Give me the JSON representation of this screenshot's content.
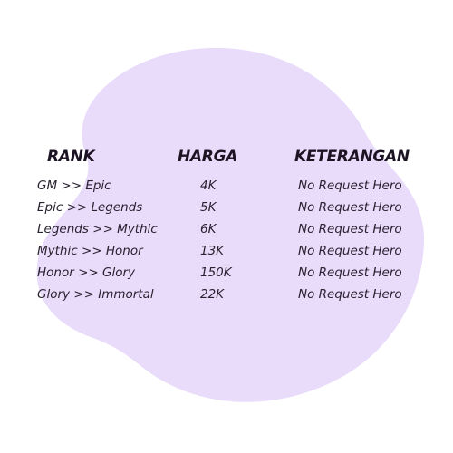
{
  "background_color": "#ffffff",
  "blob_color": "#e9dcfb",
  "text_color": "#1c1423",
  "headers": {
    "rank": "RANK",
    "harga": "HARGA",
    "keterangan": "KETERANGAN"
  },
  "rows": [
    {
      "rank": "GM >> Epic",
      "harga": "4K",
      "keterangan": "No Request Hero"
    },
    {
      "rank": "Epic >> Legends",
      "harga": "5K",
      "keterangan": "No Request Hero"
    },
    {
      "rank": "Legends >> Mythic",
      "harga": "6K",
      "keterangan": "No Request Hero"
    },
    {
      "rank": "Mythic >> Honor",
      "harga": "13K",
      "keterangan": "No Request Hero"
    },
    {
      "rank": "Honor >> Glory",
      "harga": "150K",
      "keterangan": "No Request Hero"
    },
    {
      "rank": "Glory >> Immortal",
      "harga": "22K",
      "keterangan": "No Request Hero"
    }
  ]
}
